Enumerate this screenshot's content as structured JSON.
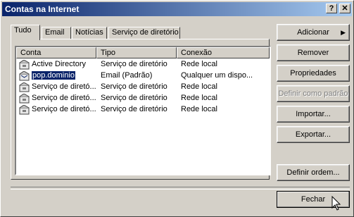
{
  "window": {
    "title": "Contas na Internet",
    "help_btn": "?",
    "close_btn": "✕"
  },
  "tabs": [
    {
      "label": "Tudo"
    },
    {
      "label": "Email"
    },
    {
      "label": "Notícias"
    },
    {
      "label": "Serviço de diretório"
    }
  ],
  "columns": [
    "Conta",
    "Tipo",
    "Conexão"
  ],
  "rows": [
    {
      "icon": "directory-icon",
      "conta": "Active Directory",
      "tipo": "Serviço de diretório",
      "conexao": "Rede local",
      "selected": false
    },
    {
      "icon": "mail-icon",
      "conta": "pop.dominio",
      "tipo": "Email (Padrão)",
      "conexao": "Qualquer um dispo...",
      "selected": true
    },
    {
      "icon": "directory-icon",
      "conta": "Serviço de diretó...",
      "tipo": "Serviço de diretório",
      "conexao": "Rede local",
      "selected": false
    },
    {
      "icon": "directory-icon",
      "conta": "Serviço de diretó...",
      "tipo": "Serviço de diretório",
      "conexao": "Rede local",
      "selected": false
    },
    {
      "icon": "directory-icon",
      "conta": "Serviço de diretó...",
      "tipo": "Serviço de diretório",
      "conexao": "Rede local",
      "selected": false
    }
  ],
  "buttons": {
    "adicionar": "Adicionar",
    "adicionar_arrow": "▶",
    "remover": "Remover",
    "propriedades": "Propriedades",
    "definir_padrao": "Definir como padrão",
    "importar": "Importar...",
    "exportar": "Exportar...",
    "definir_ordem": "Definir ordem...",
    "fechar": "Fechar"
  },
  "colors": {
    "title_start": "#0a246a",
    "title_end": "#a6caf0",
    "selection": "#0a246a",
    "face": "#d4d0c8"
  }
}
